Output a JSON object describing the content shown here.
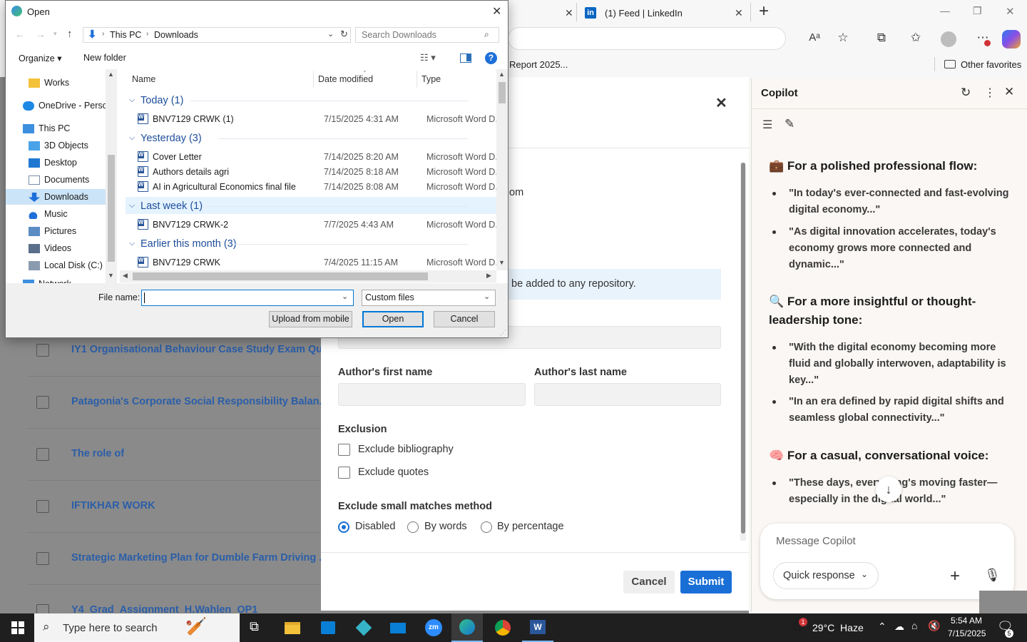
{
  "browser": {
    "tabs": [
      {
        "label": "(1) Feed | LinkedIn",
        "close": "✕"
      }
    ],
    "first_tab_close": "✕",
    "new_tab": "+",
    "favorites": {
      "item": "Report 2025...",
      "other": "Other favorites"
    },
    "window_controls": {
      "min": "—",
      "max": "❐",
      "close": "✕"
    }
  },
  "background_list": {
    "rows": [
      "IY1 Organisational Behaviour Case Study Exam Qu...",
      "Patagonia's Corporate Social Responsibility Balan...",
      "The role of",
      "IFTIKHAR WORK",
      "Strategic Marketing Plan for Dumble Farm Driving ...",
      "Y4_Grad_Assignment_H.Wahlen_OP1"
    ]
  },
  "modal": {
    "close": "✕",
    "partial_text": "om",
    "info_text": "be added to any repository.",
    "first_name_label": "Author's first name",
    "last_name_label": "Author's last name",
    "exclusion_label": "Exclusion",
    "exclude_bibliography": "Exclude bibliography",
    "exclude_quotes": "Exclude quotes",
    "small_matches_label": "Exclude small matches method",
    "radios": [
      "Disabled",
      "By words",
      "By percentage"
    ],
    "selected_radio": "Disabled",
    "cancel": "Cancel",
    "submit": "Submit",
    "accent": "#1a6fd6"
  },
  "copilot": {
    "title": "Copilot",
    "sections": [
      {
        "icon": "💼",
        "heading": "For a polished professional flow:",
        "items": [
          "\"In today's ever-connected and fast-evolving digital economy...\"",
          "\"As digital innovation accelerates, today's economy grows more connected and dynamic...\""
        ]
      },
      {
        "icon": "🔍",
        "heading": "For a more insightful or thought-leadership tone:",
        "items": [
          "\"With the digital economy becoming more fluid and globally interwoven, adaptability is key...\"",
          "\"In an era defined by rapid digital shifts and seamless global connectivity...\""
        ]
      },
      {
        "icon": "🧠",
        "heading": "For a casual, conversational voice:",
        "items": [
          "\"These days, everything's moving faster—especially in the digital world...\""
        ]
      }
    ],
    "message_placeholder": "Message Copilot",
    "quick_response": "Quick response"
  },
  "dialog": {
    "title": "Open",
    "path": [
      "This PC",
      "Downloads"
    ],
    "search_placeholder": "Search Downloads",
    "organize": "Organize",
    "new_folder": "New folder",
    "nav": [
      {
        "label": "Works",
        "icon": "folder-icon"
      },
      {
        "label": "OneDrive - Persor",
        "icon": "cloud-icon"
      },
      {
        "label": "This PC",
        "icon": "computer-icon"
      },
      {
        "label": "3D Objects",
        "icon": "cube-icon"
      },
      {
        "label": "Desktop",
        "icon": "desktop-icon"
      },
      {
        "label": "Documents",
        "icon": "document-icon"
      },
      {
        "label": "Downloads",
        "icon": "download-icon"
      },
      {
        "label": "Music",
        "icon": "music-icon"
      },
      {
        "label": "Pictures",
        "icon": "picture-icon"
      },
      {
        "label": "Videos",
        "icon": "video-icon"
      },
      {
        "label": "Local Disk (C:)",
        "icon": "disk-icon"
      },
      {
        "label": "Network",
        "icon": "network-icon"
      }
    ],
    "columns": [
      "Name",
      "Date modified",
      "Type"
    ],
    "groups": [
      {
        "label": "Today (1)",
        "files": [
          {
            "name": "BNV7129 CRWK (1)",
            "date": "7/15/2025 4:31 AM",
            "type": "Microsoft Word D..."
          }
        ]
      },
      {
        "label": "Yesterday (3)",
        "files": [
          {
            "name": "Cover Letter",
            "date": "7/14/2025 8:20 AM",
            "type": "Microsoft Word D..."
          },
          {
            "name": "Authors details agri",
            "date": "7/14/2025 8:18 AM",
            "type": "Microsoft Word D..."
          },
          {
            "name": "AI in Agricultural Economics final file",
            "date": "7/14/2025 8:08 AM",
            "type": "Microsoft Word D..."
          }
        ]
      },
      {
        "label": "Last week (1)",
        "files": [
          {
            "name": "BNV7129 CRWK-2",
            "date": "7/7/2025 4:43 AM",
            "type": "Microsoft Word D..."
          }
        ]
      },
      {
        "label": "Earlier this month (3)",
        "files": [
          {
            "name": "BNV7129 CRWK",
            "date": "7/4/2025 11:15 AM",
            "type": "Microsoft Word D..."
          }
        ]
      }
    ],
    "file_name_label": "File name:",
    "file_name_value": "",
    "file_type": "Custom files",
    "upload_mobile": "Upload from mobile",
    "open": "Open",
    "cancel": "Cancel"
  },
  "taskbar": {
    "search_placeholder": "Type here to search",
    "weather": "29°C  Haze",
    "time": "5:54 AM",
    "date": "7/15/2025",
    "notif_count": "5",
    "weather_badge": "1"
  }
}
